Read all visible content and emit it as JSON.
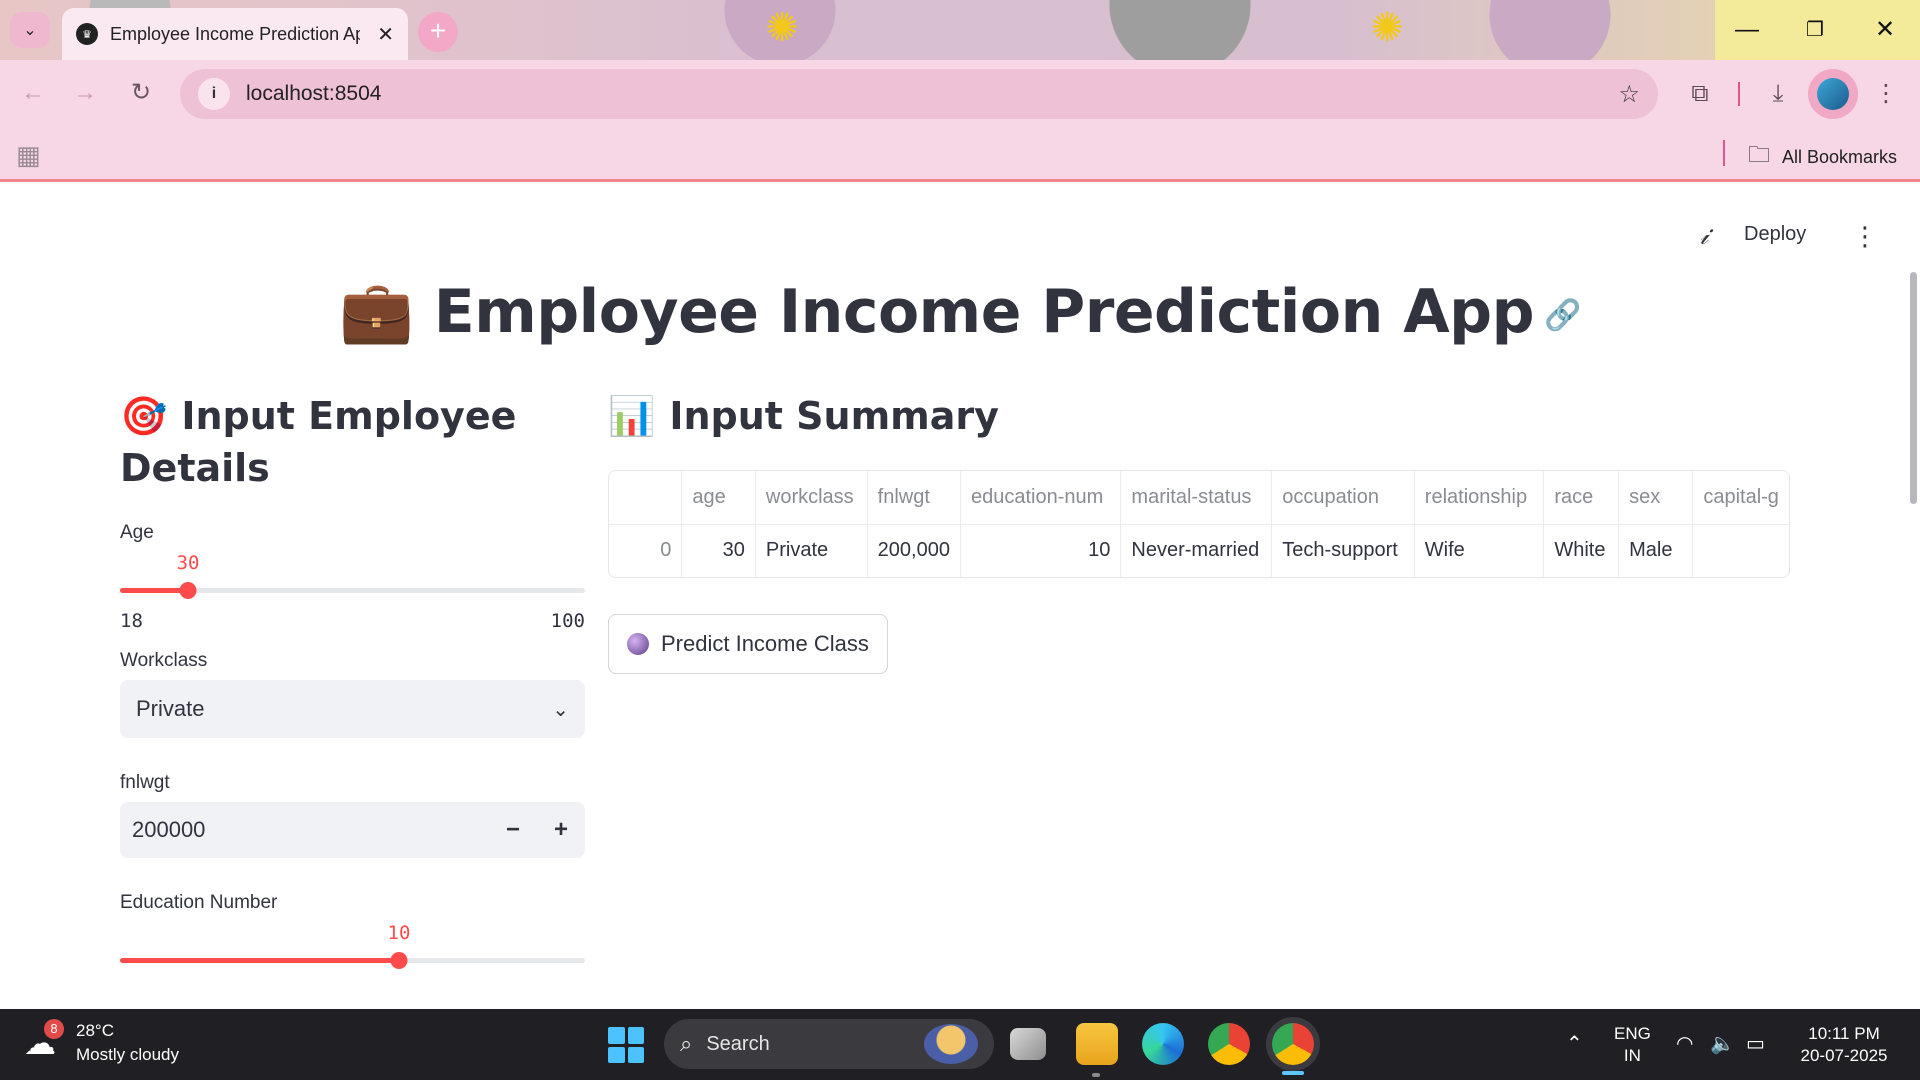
{
  "browser": {
    "tab_title": "Employee Income Prediction App",
    "url": "localhost:8504",
    "all_bookmarks": "All Bookmarks",
    "icons": [
      "tab-search-icon",
      "close-icon",
      "new-tab-icon",
      "back-icon",
      "forward-icon",
      "reload-icon",
      "site-info-icon",
      "star-icon",
      "extensions-icon",
      "download-icon",
      "menu-icon",
      "apps-icon",
      "folder-icon"
    ]
  },
  "app_header": {
    "deploy_label": "Deploy"
  },
  "page": {
    "title": "Employee Income Prediction App",
    "title_emoji": "💼"
  },
  "input_section": {
    "heading": "Input Employee Details",
    "heading_emoji": "🎯",
    "age": {
      "label": "Age",
      "value": 30,
      "min": 18,
      "max": 100,
      "value_text": "30",
      "min_text": "18",
      "max_text": "100"
    },
    "workclass": {
      "label": "Workclass",
      "selected": "Private"
    },
    "fnlwgt": {
      "label": "fnlwgt",
      "value": "200000"
    },
    "education_num": {
      "label": "Education Number",
      "value": 10,
      "min": 1,
      "max": 16,
      "value_text": "10"
    }
  },
  "summary_section": {
    "heading": "Input Summary",
    "heading_emoji": "📊",
    "columns": [
      "",
      "age",
      "workclass",
      "fnlwgt",
      "education-num",
      "marital-status",
      "occupation",
      "relationship",
      "race",
      "sex",
      "capital-g"
    ],
    "rows": [
      [
        "0",
        "30",
        "Private",
        "200,000",
        "10",
        "Never-married",
        "Tech-support",
        "Wife",
        "White",
        "Male",
        ""
      ]
    ],
    "predict_button": "Predict Income Class"
  },
  "taskbar": {
    "weather_temp": "28°C",
    "weather_desc": "Mostly cloudy",
    "weather_badge": "8",
    "search_placeholder": "Search",
    "lang_top": "ENG",
    "lang_bottom": "IN",
    "time": "10:11 PM",
    "date": "20-07-2025"
  },
  "colors": {
    "accent": "#ff4b4b",
    "text": "#31333f",
    "chrome_pink": "#f7d7e6"
  }
}
